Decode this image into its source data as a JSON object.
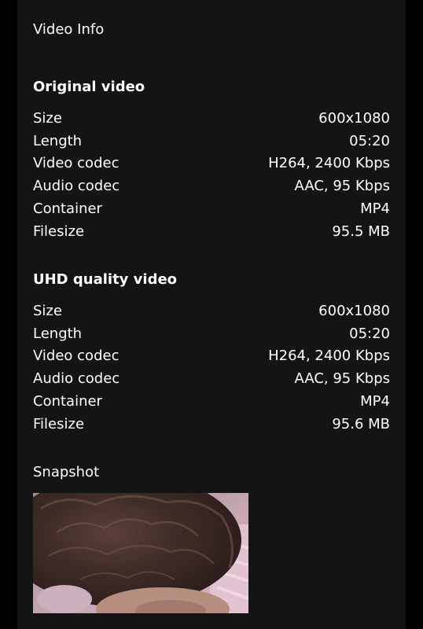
{
  "title": "Video Info",
  "sections": [
    {
      "heading": "Original video",
      "rows": [
        {
          "label": "Size",
          "value": "600x1080"
        },
        {
          "label": "Length",
          "value": "05:20"
        },
        {
          "label": "Video codec",
          "value": "H264, 2400 Kbps"
        },
        {
          "label": "Audio codec",
          "value": "AAC, 95 Kbps"
        },
        {
          "label": "Container",
          "value": "MP4"
        },
        {
          "label": "Filesize",
          "value": "95.5 MB"
        }
      ]
    },
    {
      "heading": "UHD quality video",
      "rows": [
        {
          "label": "Size",
          "value": "600x1080"
        },
        {
          "label": "Length",
          "value": "05:20"
        },
        {
          "label": "Video codec",
          "value": "H264, 2400 Kbps"
        },
        {
          "label": "Audio codec",
          "value": "AAC, 95 Kbps"
        },
        {
          "label": "Container",
          "value": "MP4"
        },
        {
          "label": "Filesize",
          "value": "95.6 MB"
        }
      ]
    }
  ],
  "snapshot": {
    "label": "Snapshot"
  }
}
